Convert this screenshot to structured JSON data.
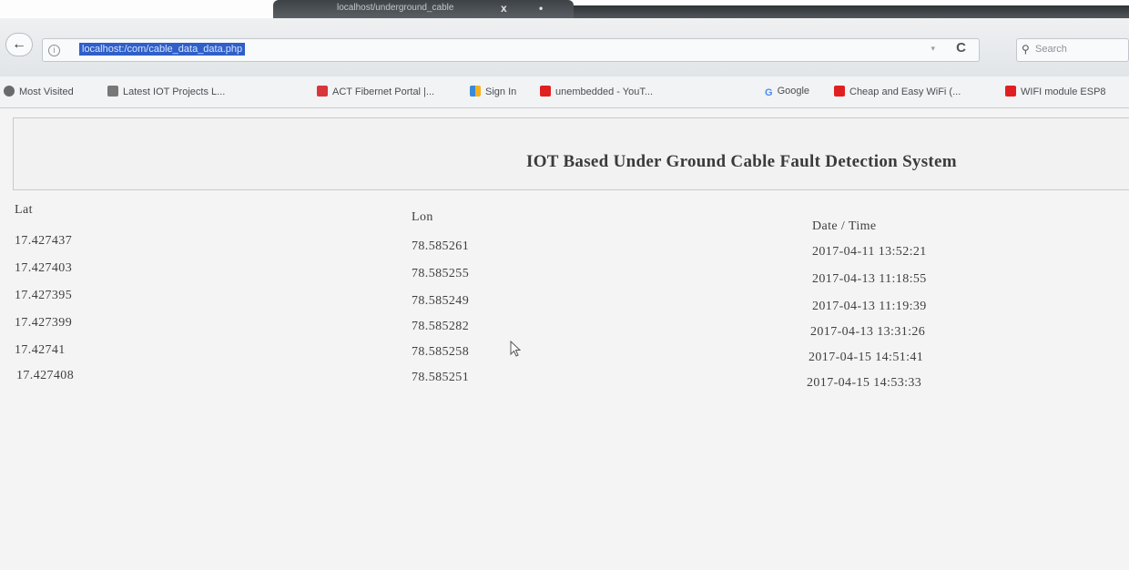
{
  "browser": {
    "tab": {
      "title": "localhost/underground_cable",
      "close": "x"
    },
    "back_icon": "back-arrow-icon",
    "address": {
      "info": "i",
      "url": "localhost:/com/cable_data_data.php",
      "reload": "C",
      "dropdown": "▾"
    },
    "search": {
      "placeholder": "Search"
    },
    "bookmarks": [
      {
        "label": "Most Visited",
        "icon": "gear-icon",
        "color": "#6a6a6a"
      },
      {
        "label": "Latest IOT Projects L...",
        "icon": "bookmark-icon",
        "color": "#777777"
      },
      {
        "label": "ACT Fibernet Portal |...",
        "icon": "act-icon",
        "color": "#d8363a"
      },
      {
        "label": "Sign In",
        "icon": "windows-icon",
        "color": "#3a8ad6"
      },
      {
        "label": "unembedded - YouT...",
        "icon": "youtube-icon",
        "color": "#e02020"
      },
      {
        "label": "Google",
        "icon": "google-icon",
        "color": "#4a8af4"
      },
      {
        "label": "Cheap and Easy WiFi (...",
        "icon": "youtube-icon",
        "color": "#e02020"
      },
      {
        "label": "WIFI module ESP8",
        "icon": "youtube-icon",
        "color": "#e02020"
      }
    ]
  },
  "page": {
    "title": "IOT Based Under Ground Cable Fault Detection System",
    "columns": {
      "lat": "Lat",
      "lon": "Lon",
      "datetime": "Date / Time"
    },
    "rows": [
      {
        "lat": "17.427437",
        "lon": "78.585261",
        "datetime": "2017-04-11 13:52:21"
      },
      {
        "lat": "17.427403",
        "lon": "78.585255",
        "datetime": "2017-04-13 11:18:55"
      },
      {
        "lat": "17.427395",
        "lon": "78.585249",
        "datetime": "2017-04-13 11:19:39"
      },
      {
        "lat": "17.427399",
        "lon": "78.585282",
        "datetime": "2017-04-13 13:31:26"
      },
      {
        "lat": "17.42741",
        "lon": "78.585258",
        "datetime": "2017-04-15 14:51:41"
      },
      {
        "lat": "17.427408",
        "lon": "78.585251",
        "datetime": "2017-04-15 14:53:33"
      }
    ]
  },
  "colors": {
    "url_highlight": "#2f5fc8",
    "page_bg": "#f4f4f4",
    "tab_bg": "#3d4246"
  }
}
